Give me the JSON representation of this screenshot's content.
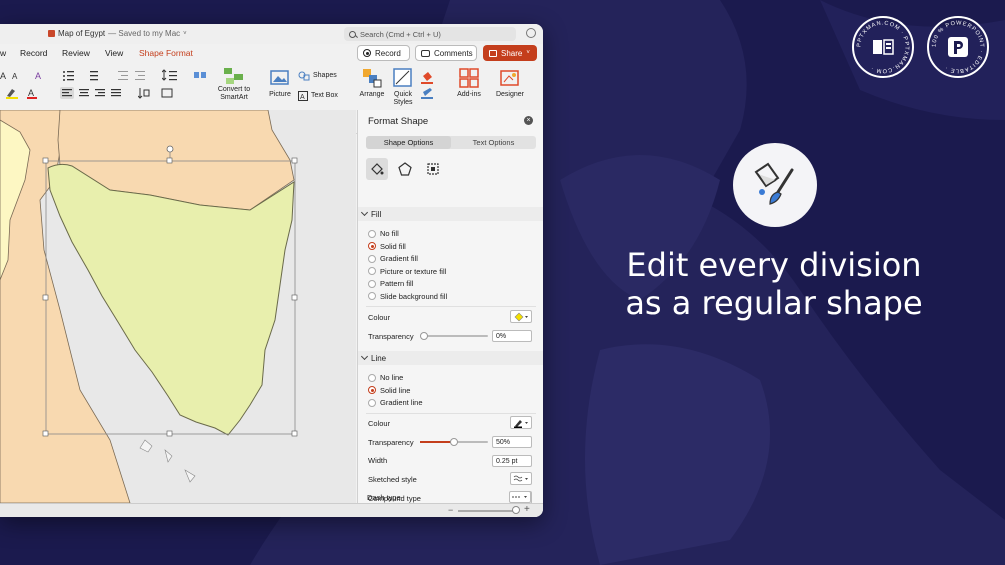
{
  "window": {
    "doc_title": "Map of Egypt",
    "doc_status": "— Saved to my Mac",
    "search_placeholder": "Search (Cmd + Ctrl + U)"
  },
  "tabs": [
    {
      "label": "w"
    },
    {
      "label": "Record"
    },
    {
      "label": "Review"
    },
    {
      "label": "View"
    },
    {
      "label": "Shape Format"
    }
  ],
  "actions": {
    "record": "Record",
    "comments": "Comments",
    "share": "Share"
  },
  "ribbon": {
    "convert_smartart_line1": "Convert to",
    "convert_smartart_line2": "SmartArt",
    "picture": "Picture",
    "shapes": "Shapes",
    "text_box": "Text Box",
    "arrange": "Arrange",
    "quick_styles_line1": "Quick",
    "quick_styles_line2": "Styles",
    "add_ins": "Add-ins",
    "designer": "Designer"
  },
  "pane": {
    "title": "Format Shape",
    "seg_shape": "Shape Options",
    "seg_text": "Text Options",
    "fill_section": "Fill",
    "fill_options": [
      "No fill",
      "Solid fill",
      "Gradient fill",
      "Picture or texture fill",
      "Pattern fill",
      "Slide background fill"
    ],
    "fill_selected": 1,
    "colour_label": "Colour",
    "transparency_label": "Transparency",
    "fill_transparency": "0%",
    "fill_transparency_value": 0,
    "line_section": "Line",
    "line_options": [
      "No line",
      "Solid line",
      "Gradient line"
    ],
    "line_selected": 1,
    "line_colour_label": "Colour",
    "line_transparency_label": "Transparency",
    "line_transparency": "50%",
    "line_transparency_value": 50,
    "width_label": "Width",
    "width_value": "0.25 pt",
    "sketched_label": "Sketched style",
    "compound_label": "Compound type",
    "dash_label": "Dash type"
  },
  "hero": {
    "line1": "Edit every division",
    "line2": "as a regular shape"
  },
  "badges": {
    "left": "PPTXMAN.COM · PPTXMAN.COM ·",
    "right": "100 % POWERPOINT · EDITABLE ·"
  },
  "colors": {
    "background": "#1b1a4e",
    "accent": "#c43e1c",
    "sinai_fill": "#e8efad",
    "land_orange": "#f8d9b0",
    "land_yellow": "#fdf7c3"
  }
}
